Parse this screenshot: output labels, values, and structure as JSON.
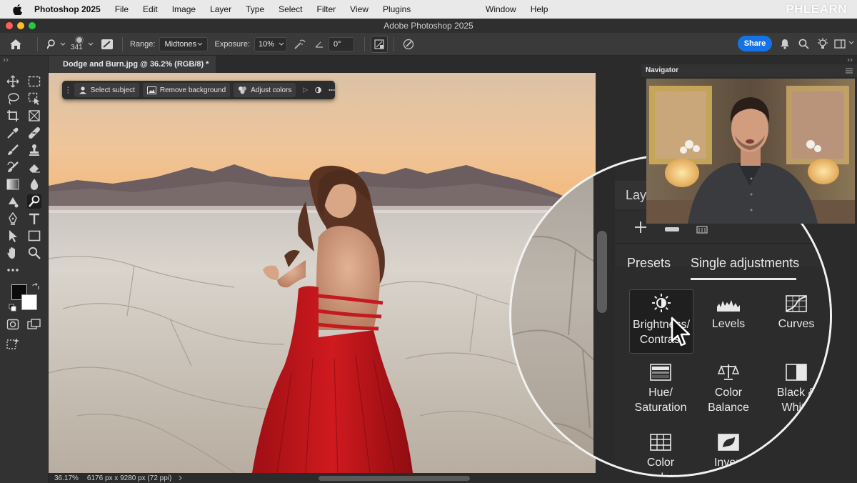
{
  "menubar": {
    "app": "Photoshop 2025",
    "items": [
      "File",
      "Edit",
      "Image",
      "Layer",
      "Type",
      "Select",
      "Filter",
      "View",
      "Plugins"
    ],
    "right_items": [
      "Window",
      "Help"
    ],
    "brand": "PHLEARN"
  },
  "window": {
    "title": "Adobe Photoshop 2025"
  },
  "options": {
    "brush_size": "341",
    "range_label": "Range:",
    "range_value": "Midtones",
    "exposure_label": "Exposure:",
    "exposure_value": "10%",
    "angle_value": "0°",
    "share_label": "Share"
  },
  "document": {
    "tab_title": "Dodge and Burn.jpg @ 36.2% (RGB/8) *",
    "zoom": "36.17%",
    "info": "6176 px x 9280 px (72 ppi)"
  },
  "taskbar": {
    "select_subject": "Select subject",
    "remove_background": "Remove background",
    "adjust_colors": "Adjust colors"
  },
  "panels": {
    "navigator": "Navigator",
    "layers_partial": "Lay",
    "tabs": [
      "Presets",
      "Single adjustments"
    ],
    "active_tab": "Single adjustments",
    "adjustments": [
      {
        "line1": "Brightness/",
        "line2": "Contrast",
        "icon": "brightness-icon",
        "selected": true
      },
      {
        "line1": "Levels",
        "line2": "",
        "icon": "levels-icon",
        "selected": false
      },
      {
        "line1": "Curves",
        "line2": "",
        "icon": "curves-icon",
        "selected": false
      },
      {
        "line1": "Hue/",
        "line2": "Saturation",
        "icon": "hue-saturation-icon",
        "selected": false
      },
      {
        "line1": "Color",
        "line2": "Balance",
        "icon": "color-balance-icon",
        "selected": false
      },
      {
        "line1": "Black &",
        "line2": "White",
        "icon": "black-white-icon",
        "selected": false
      },
      {
        "line1": "Color",
        "line2": "Lookup",
        "icon": "color-lookup-icon",
        "selected": false
      },
      {
        "line1": "Invert",
        "line2": "",
        "icon": "invert-icon",
        "selected": false
      }
    ]
  },
  "colors": {
    "accent": "#1473e6",
    "dress": "#c4161c",
    "sky_top": "#e9cba8",
    "sky_horizon": "#f2b57a"
  }
}
